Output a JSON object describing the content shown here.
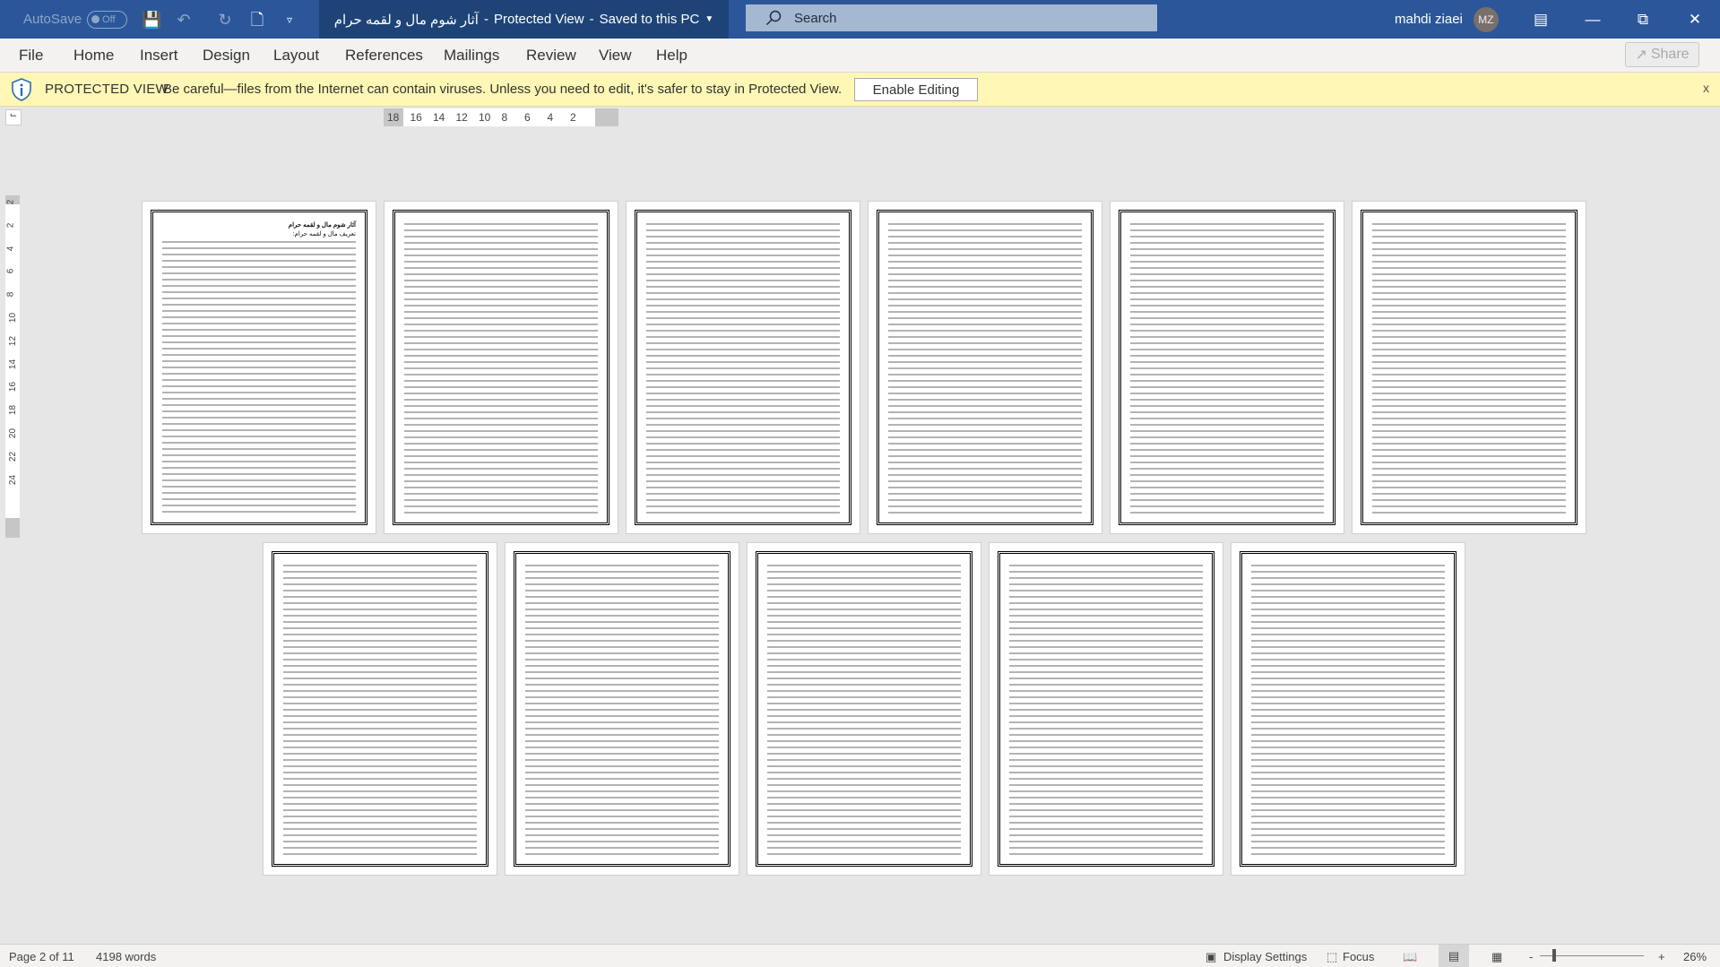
{
  "titlebar": {
    "autosave_label": "AutoSave",
    "autosave_state": "Off",
    "doc_title": "آثار شوم مال و لقمه حرام",
    "title_sep1": "-",
    "view_mode": "Protected View",
    "title_sep2": "-",
    "save_state": "Saved to this PC",
    "search_placeholder": "Search",
    "user_name": "mahdi ziaei",
    "user_initials": "MZ",
    "accent": "#2b579a"
  },
  "ribbon": {
    "tabs": [
      "File",
      "Home",
      "Insert",
      "Design",
      "Layout",
      "References",
      "Mailings",
      "Review",
      "View",
      "Help"
    ],
    "share_label": "Share"
  },
  "protected": {
    "title": "PROTECTED VIEW",
    "message": "Be careful—files from the Internet can contain viruses. Unless you need to edit, it's safer to stay in Protected View.",
    "button": "Enable Editing",
    "close": "x",
    "bg": "#fef7b5"
  },
  "ruler": {
    "h_ticks": [
      "18",
      "16",
      "14",
      "12",
      "10",
      "8",
      "6",
      "4",
      "2"
    ],
    "v_ticks": [
      "2",
      "2",
      "4",
      "6",
      "8",
      "10",
      "12",
      "14",
      "16",
      "18",
      "20",
      "22",
      "24"
    ]
  },
  "document": {
    "page1_heading": "آثار شوم مال و لقمه حرام",
    "page1_subheading": "تعریف مال و لقمه حرام:"
  },
  "status": {
    "page": "Page 2 of 11",
    "words": "4198 words",
    "display_settings": "Display Settings",
    "focus": "Focus",
    "zoom_out": "-",
    "zoom_in": "+",
    "zoom": "26%",
    "zoom_percent": 26
  }
}
